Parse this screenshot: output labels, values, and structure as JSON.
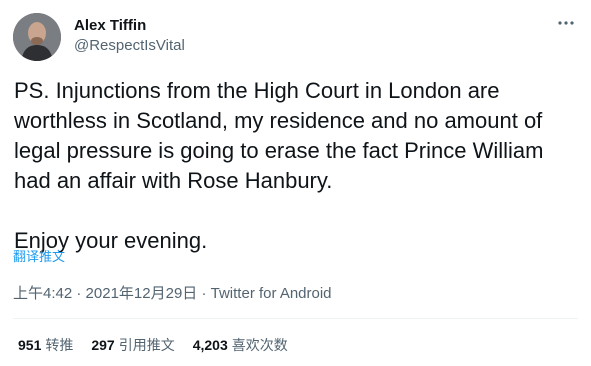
{
  "author": {
    "name": "Alex Tiffin",
    "handle": "@RespectIsVital",
    "avatar_icon": "profile-photo"
  },
  "tweet": {
    "text": "PS. Injunctions from the High Court in London are\nworthless in Scotland, my residence and no amount of\nlegal pressure is going to erase the fact Prince William\nhad an affair with Rose Hanbury.\n\nEnjoy your evening.",
    "translate_label": "翻译推文",
    "time": "上午4:42",
    "date": "2021年12月29日",
    "separator": "·",
    "source": "Twitter for Android"
  },
  "stats": {
    "retweets_count": "951",
    "retweets_label": "转推",
    "quotes_count": "297",
    "quotes_label": "引用推文",
    "likes_count": "4,203",
    "likes_label": "喜欢次数"
  },
  "icons": {
    "more": "more-horizontal-icon"
  },
  "colors": {
    "text": "#0f1419",
    "secondary": "#536471",
    "link": "#1d9bf0",
    "divider": "#eff3f4"
  }
}
